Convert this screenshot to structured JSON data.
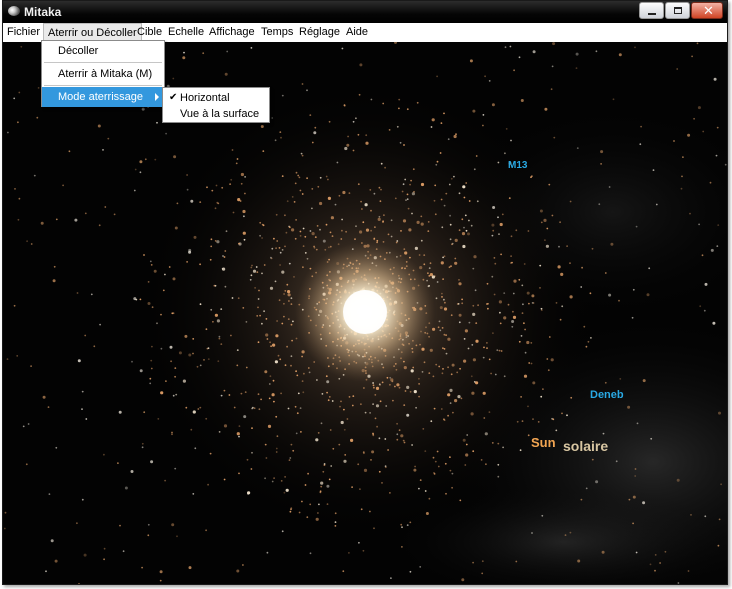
{
  "window": {
    "title": "Mitaka"
  },
  "menubar": {
    "items": [
      "Fichier",
      "Aterrir ou Décoller",
      "Cible",
      "Echelle",
      "Affichage",
      "Temps",
      "Réglage",
      "Aide"
    ]
  },
  "dropdown": {
    "items": [
      "Décoller",
      "Aterrir à  Mitaka (M)",
      "Mode aterrissage"
    ]
  },
  "submenu": {
    "items": [
      "Horizontal",
      "Vue à la surface"
    ],
    "checked_item": "Horizontal"
  },
  "scene": {
    "labels": [
      "M13",
      "Deneb",
      "Sun",
      "solaire"
    ],
    "colors": {
      "star_label": "#29a9e4",
      "sun_label": "#f2a552",
      "system_label": "#d8c6a2",
      "cluster_glow": "#fff6dc"
    }
  }
}
